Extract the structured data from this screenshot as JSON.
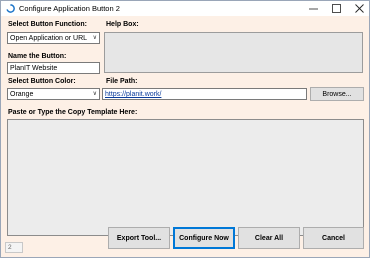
{
  "window": {
    "title": "Configure Application Button 2"
  },
  "form": {
    "function_label": "Select Button Function:",
    "function_value": "Open Application or URL",
    "name_label": "Name the Button:",
    "name_value": "PlanIT Website",
    "color_label": "Select Button Color:",
    "color_value": "Orange",
    "help_label": "Help Box:",
    "filepath_label": "File Path:",
    "filepath_value": "https://planit.work/",
    "browse_label": "Browse...",
    "template_label": "Paste or Type the Copy Template Here:"
  },
  "buttons": {
    "export": "Export Tool...",
    "configure": "Configure Now",
    "clear": "Clear All",
    "cancel": "Cancel"
  },
  "status": {
    "value": "2"
  },
  "icons": {
    "app": "refresh-circle-icon",
    "dropdown": "chevron-down-icon"
  }
}
